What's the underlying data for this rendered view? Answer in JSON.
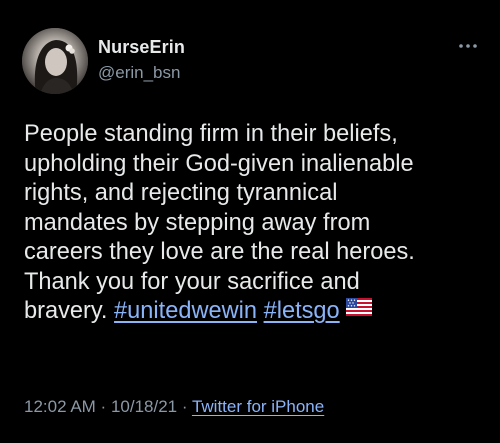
{
  "author": {
    "display_name": "NurseErin",
    "handle": "@erin_bsn"
  },
  "tweet": {
    "lines": [
      "People standing firm in their beliefs,",
      "upholding their God-given inalienable",
      "rights, and rejecting tyrannical",
      "mandates by stepping away from",
      "careers they love are the real heroes.",
      "Thank you for your sacrifice and",
      "bravery."
    ],
    "hashtags": [
      "#unitedwewin",
      "#letsgo"
    ],
    "emoji": "us-flag-icon"
  },
  "meta": {
    "time": "12:02 AM",
    "separator_1": " · ",
    "date": "10/18/21",
    "separator_2": " · ",
    "source": "Twitter for iPhone"
  },
  "icons": {
    "more": "more-horizontal-icon",
    "avatar": "avatar"
  },
  "colors": {
    "background": "#000000",
    "text": "#e7e9ea",
    "secondary": "#8b98a5",
    "link": "#8ab4f8"
  }
}
